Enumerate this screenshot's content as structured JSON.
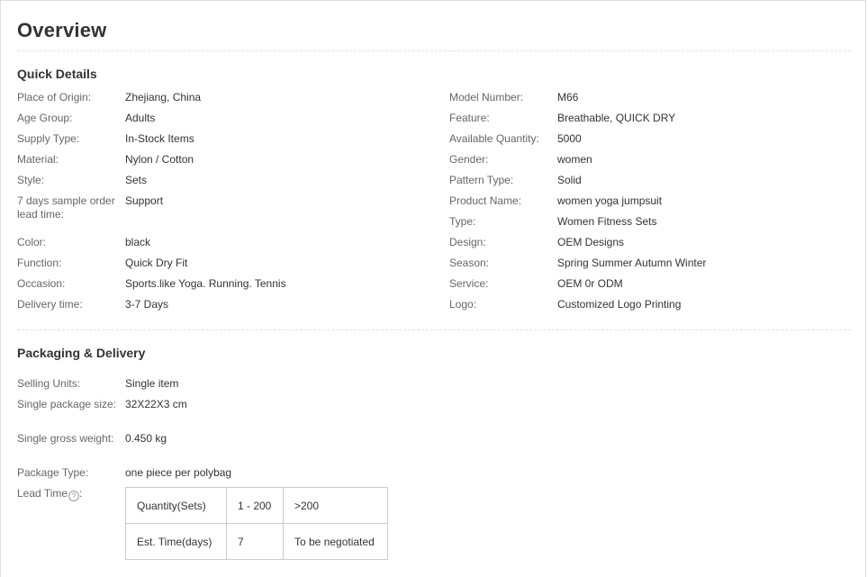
{
  "overview": {
    "title": "Overview"
  },
  "quick_details": {
    "title": "Quick Details",
    "left": [
      {
        "label": "Place of Origin:",
        "value": "Zhejiang, China"
      },
      {
        "label": "Age Group:",
        "value": "Adults"
      },
      {
        "label": "Supply Type:",
        "value": "In-Stock Items"
      },
      {
        "label": "Material:",
        "value": "Nylon / Cotton"
      },
      {
        "label": "Style:",
        "value": "Sets"
      },
      {
        "label": "7 days sample order lead time:",
        "value": "Support"
      },
      {
        "label": "Color:",
        "value": "black"
      },
      {
        "label": "Function:",
        "value": "Quick Dry Fit"
      },
      {
        "label": "Occasion:",
        "value": "Sports.like Yoga. Running. Tennis"
      },
      {
        "label": "Delivery time:",
        "value": "3-7 Days"
      }
    ],
    "right": [
      {
        "label": "Model Number:",
        "value": "M66"
      },
      {
        "label": "Feature:",
        "value": "Breathable, QUICK DRY"
      },
      {
        "label": "Available Quantity:",
        "value": "5000"
      },
      {
        "label": "Gender:",
        "value": "women"
      },
      {
        "label": "Pattern Type:",
        "value": "Solid"
      },
      {
        "label": "Product Name:",
        "value": "women yoga jumpsuit"
      },
      {
        "label": "Type:",
        "value": "Women Fitness Sets"
      },
      {
        "label": "Design:",
        "value": "OEM Designs"
      },
      {
        "label": "Season:",
        "value": "Spring Summer Autumn Winter"
      },
      {
        "label": "Service:",
        "value": "OEM 0r ODM"
      },
      {
        "label": "Logo:",
        "value": "Customized Logo Printing"
      }
    ]
  },
  "packaging": {
    "title": "Packaging & Delivery",
    "items": [
      {
        "label": "Selling Units:",
        "value": "Single item"
      },
      {
        "label": "Single package size:",
        "value": "32X22X3 cm"
      },
      {
        "label": "Single gross weight:",
        "value": "0.450 kg"
      },
      {
        "label": "Package Type:",
        "value": "one piece per polybag"
      }
    ],
    "lead_time": {
      "label": "Lead Time",
      "help_icon": "?",
      "label_suffix": ":",
      "rows": [
        [
          "Quantity(Sets)",
          "1 - 200",
          ">200"
        ],
        [
          "Est. Time(days)",
          "7",
          "To be negotiated"
        ]
      ]
    }
  }
}
